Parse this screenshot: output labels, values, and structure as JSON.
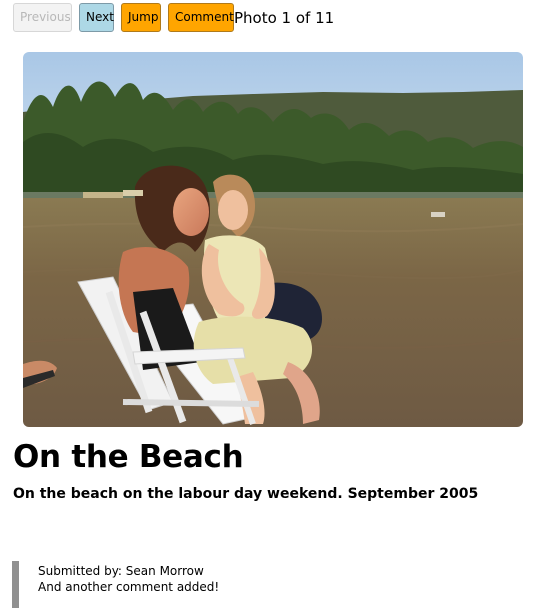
{
  "toolbar": {
    "previous_label": "Previous",
    "next_label": "Next",
    "jump_label": "Jump",
    "comment_label": "Comment",
    "photo_counter": "Photo 1 of 11"
  },
  "photo": {
    "title": "On the Beach",
    "caption": "On the beach on the labour day weekend. September 2005"
  },
  "comments": [
    {
      "submitted_by": "Submitted by: Sean Morrow",
      "text": "And another comment added!"
    }
  ],
  "colors": {
    "next_button": "#add8e6",
    "jump_button": "#ffa500",
    "comment_button": "#ffa500",
    "disabled_button": "#f3f3f3",
    "comment_border": "#909090"
  }
}
